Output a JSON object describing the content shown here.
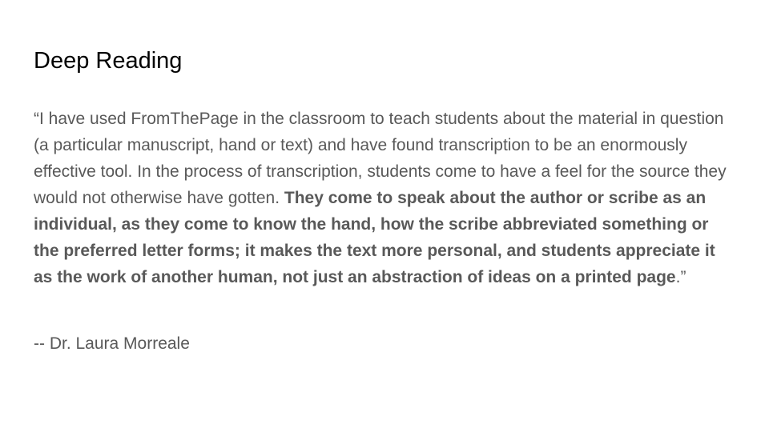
{
  "slide": {
    "title": "Deep Reading",
    "quote": {
      "plain_part": "“I have used FromThePage in the classroom to teach students about the material in question (a particular manuscript, hand or text) and have found transcription to be an enormously effective tool. In the process of transcription, students come to have a feel for the source they would not otherwise have gotten. ",
      "bold_part": "They come to speak about the author or scribe as an individual, as they come to know the hand, how the scribe abbreviated something or the preferred letter forms; it makes the text more personal, and students appreciate it as the work of another human, not just an abstraction of ideas on a printed page",
      "closing": ".”"
    },
    "attribution": "-- Dr. Laura Morreale"
  },
  "colors": {
    "title": "#000000",
    "body_text": "#595959",
    "background": "#ffffff"
  }
}
